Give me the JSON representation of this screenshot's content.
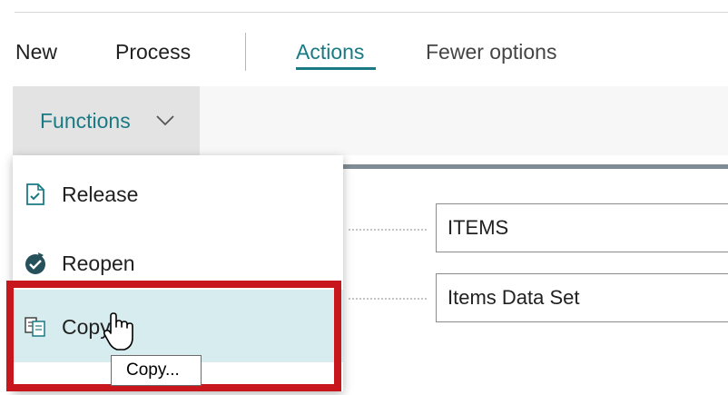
{
  "action_bar": {
    "items": [
      {
        "label": "New"
      },
      {
        "label": "Process"
      },
      {
        "label": "Actions",
        "active": true
      },
      {
        "label": "Fewer options"
      }
    ]
  },
  "sub_bar": {
    "functions_label": "Functions",
    "functions_icon": "chevron-down-icon"
  },
  "menu": {
    "items": [
      {
        "label": "Release",
        "icon": "release-document-icon"
      },
      {
        "label": "Reopen",
        "icon": "reopen-icon"
      },
      {
        "label": "Copy",
        "icon": "copy-icon"
      }
    ]
  },
  "tooltip": {
    "text": "Copy..."
  },
  "fields": [
    {
      "value": "ITEMS"
    },
    {
      "value": "Items Data Set"
    }
  ],
  "colors": {
    "accent": "#1a7a84",
    "highlight": "#c8161d",
    "menu_hover": "#d7ecee"
  }
}
